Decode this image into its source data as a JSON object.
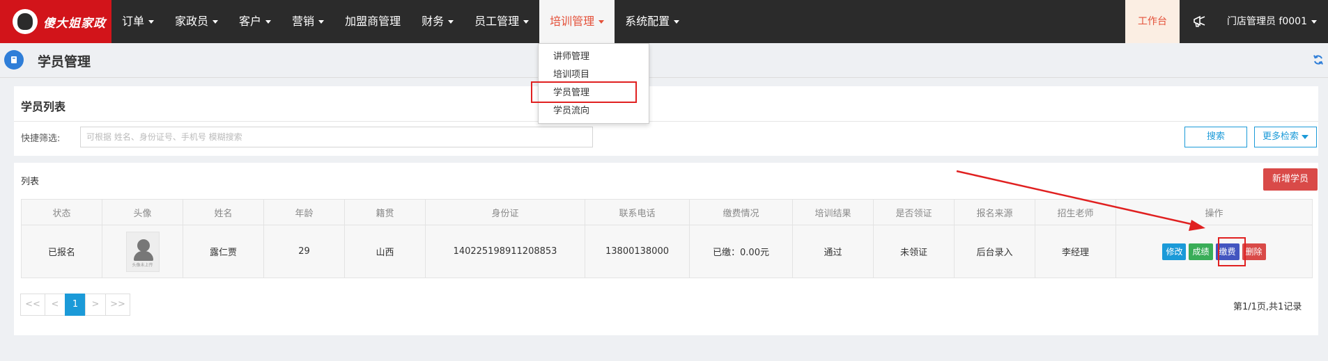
{
  "brand": {
    "name": "傻大姐家政"
  },
  "nav": {
    "items": [
      {
        "label": "订单",
        "caret": true
      },
      {
        "label": "家政员",
        "caret": true
      },
      {
        "label": "客户",
        "caret": true
      },
      {
        "label": "营销",
        "caret": true
      },
      {
        "label": "加盟商管理",
        "caret": false
      },
      {
        "label": "财务",
        "caret": true
      },
      {
        "label": "员工管理",
        "caret": true
      },
      {
        "label": "培训管理",
        "caret": true,
        "active": true
      },
      {
        "label": "系统配置",
        "caret": true
      }
    ],
    "workbench": "工作台",
    "user": "门店管理员 f0001",
    "user_caret": true
  },
  "dropdown": {
    "items": [
      "讲师管理",
      "培训项目",
      "学员管理",
      "学员流向"
    ],
    "highlighted": "学员管理"
  },
  "page": {
    "title": "学员管理"
  },
  "filter": {
    "title": "学员列表",
    "label": "快捷筛选:",
    "placeholder": "可根据 姓名、身份证号、手机号 模糊搜索",
    "search_button": "搜索",
    "more_button": "更多检索"
  },
  "list": {
    "label": "列表",
    "add_button": "新增学员",
    "columns": [
      "状态",
      "头像",
      "姓名",
      "年龄",
      "籍贯",
      "身份证",
      "联系电话",
      "缴费情况",
      "培训结果",
      "是否领证",
      "报名来源",
      "招生老师",
      "操作"
    ],
    "rows": [
      {
        "status": "已报名",
        "avatar_caption": "头像未上传",
        "name": "露仁贾",
        "age": "29",
        "hometown": "山西",
        "id_card": "140225198911208853",
        "phone": "13800138000",
        "payment": "已缴：0.00元",
        "result": "通过",
        "certificate": "未领证",
        "source": "后台录入",
        "teacher": "李经理",
        "actions": [
          "修改",
          "成绩",
          "缴费",
          "删除"
        ]
      }
    ]
  },
  "pagination": {
    "buttons": [
      "<<",
      "<",
      "1",
      ">",
      ">>"
    ],
    "current": "1",
    "info": "第1/1页,共1记录"
  },
  "colors": {
    "topbar": "#2b2b2b",
    "brand_red": "#d2141a",
    "accent": "#e4513a",
    "primary_blue": "#1b9ad8",
    "danger": "#d94a48",
    "success": "#3aad58",
    "pay": "#4355c0",
    "annotation": "#e02020"
  }
}
